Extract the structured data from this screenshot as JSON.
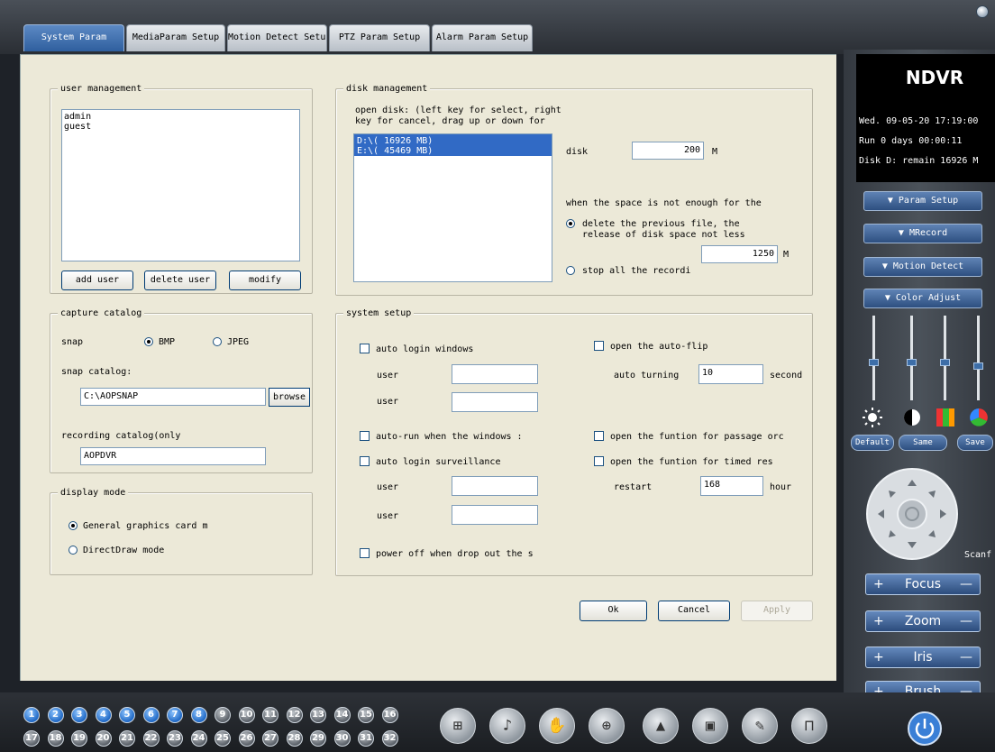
{
  "tabs": [
    "System Param",
    "MediaParam Setup",
    "Motion Detect Setup",
    "PTZ Param Setup",
    "Alarm Param Setup"
  ],
  "user_management": {
    "title": "user management",
    "users": [
      "admin",
      "guest"
    ],
    "add_user": "add user",
    "delete_user": "delete user",
    "modify": "modify"
  },
  "capture_catalog": {
    "title": "capture catalog",
    "snap_label": "snap",
    "bmp": "BMP",
    "jpeg": "JPEG",
    "snap_catalog_label": "snap catalog:",
    "snap_catalog_value": "C:\\AOPSNAP",
    "browse": "browse",
    "recording_catalog_label": "recording catalog(only",
    "recording_catalog_value": "AOPDVR"
  },
  "display_mode": {
    "title": "display mode",
    "general": "General graphics card m",
    "directdraw": "DirectDraw mode"
  },
  "disk_management": {
    "title": "disk management",
    "hint_line1": "open disk: (left key for select, right",
    "hint_line2": "key for cancel, drag up or down for",
    "disks": [
      "D:\\( 16926 MB)",
      "E:\\( 45469 MB)"
    ],
    "disk_label": "disk",
    "disk_value": "200",
    "disk_unit": "M",
    "space_label": "when the space is not enough for the",
    "delete_line1": "delete the previous file, the",
    "delete_line2": "release of disk space not less",
    "release_value": "1250",
    "release_unit": "M",
    "stop_all": "stop all the recordi"
  },
  "system_setup": {
    "title": "system setup",
    "auto_login_windows": "auto login windows",
    "user1": "user",
    "user2": "user",
    "auto_run": "auto-run when the windows :",
    "auto_login_surveillance": "auto login surveillance",
    "user3": "user",
    "user4": "user",
    "power_off": "power off when drop out the s",
    "auto_flip": "open the auto-flip",
    "auto_turning": "auto turning",
    "auto_turning_value": "10",
    "second": "second",
    "passage_order": "open the funtion for passage orc",
    "timed_restart": "open the funtion for timed res",
    "restart": "restart",
    "restart_value": "168",
    "hour": "hour"
  },
  "dialog_buttons": {
    "ok": "Ok",
    "cancel": "Cancel",
    "apply": "Apply"
  },
  "sidebar": {
    "logo": "NDVR",
    "date": "Wed.   09-05-20 17:19:00",
    "run": "Run 0 days 00:00:11",
    "disk": "Disk D: remain 16926 M",
    "buttons": [
      "▼ Param Setup",
      "▼   MRecord",
      "▼ Motion Detect",
      "▼ Color Adjust"
    ],
    "default": "Default",
    "same": "Same",
    "save": "Save",
    "scan": "Scanf",
    "focus": "Focus",
    "zoom": "Zoom",
    "iris": "Iris",
    "brush": "Brush",
    "plus": "+",
    "minus": "—"
  },
  "channels_top": [
    "1",
    "2",
    "3",
    "4",
    "5",
    "6",
    "7",
    "8",
    "9",
    "10",
    "11",
    "12",
    "13",
    "14",
    "15",
    "16"
  ],
  "channels_bottom": [
    "17",
    "18",
    "19",
    "20",
    "21",
    "22",
    "23",
    "24",
    "25",
    "26",
    "27",
    "28",
    "29",
    "30",
    "31",
    "32"
  ],
  "toolbar_icons": [
    "layout-icon",
    "speaker-icon",
    "hand-icon",
    "globe-icon",
    "alarm-icon",
    "film-icon",
    "pen-icon",
    "lock-icon"
  ],
  "colors": {
    "accent": "#2f5f9e",
    "panel": "#ece9d8",
    "active_channel": "#1f68c5"
  }
}
